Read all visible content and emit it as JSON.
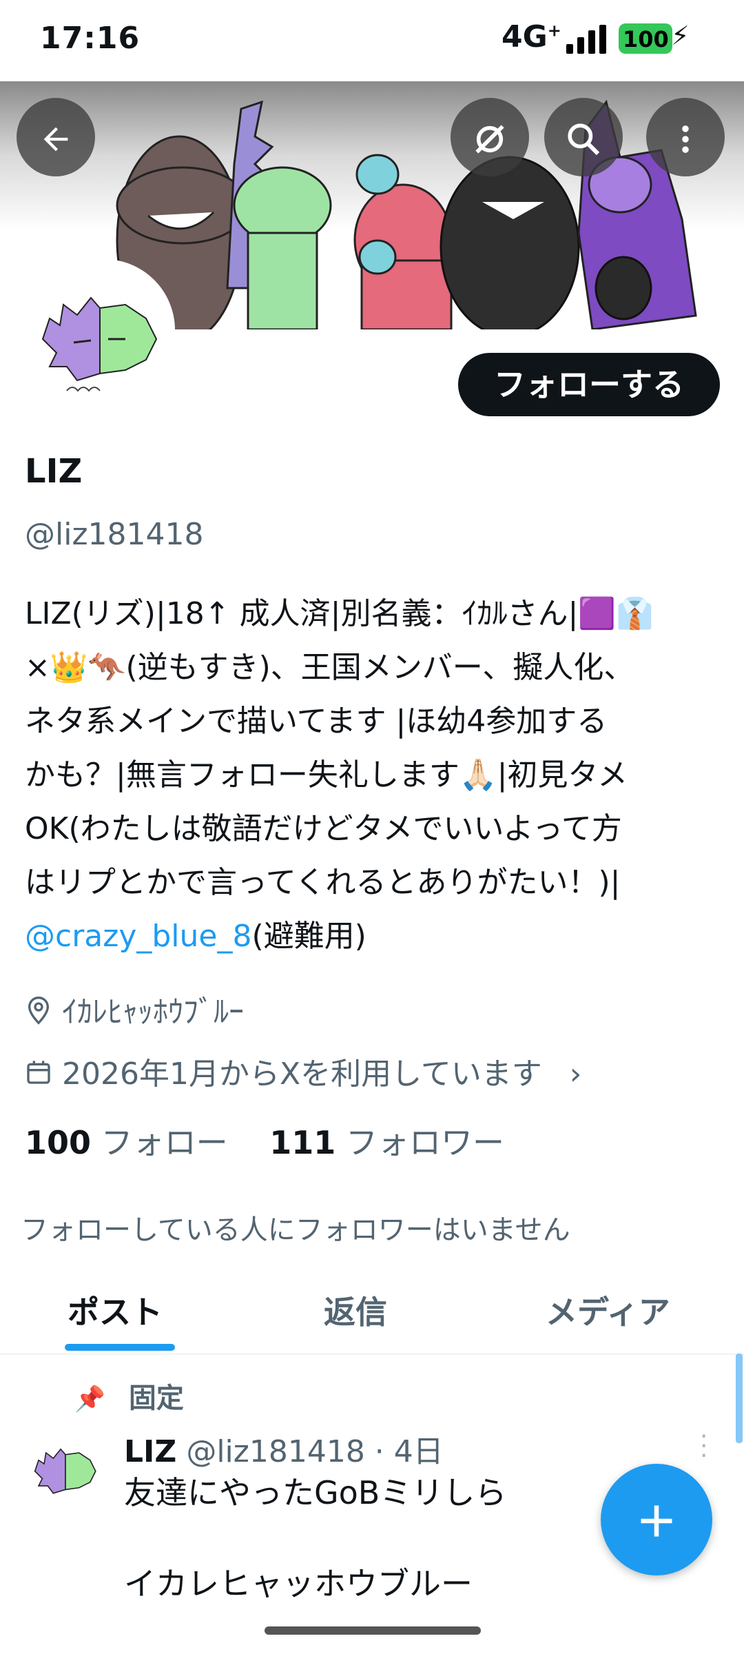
{
  "status_bar": {
    "time": "17:16",
    "network": "4G",
    "network_sup": "+",
    "battery": "100"
  },
  "header": {
    "back_icon": "arrow-left-icon",
    "grok_icon": "grok-icon",
    "search_icon": "search-icon",
    "more_icon": "more-vertical-icon"
  },
  "profile": {
    "follow_button": "フォローする",
    "name": "LIZ",
    "handle": "@liz181418",
    "bio_line1": "LIZ(リズ)|18↑ 成人済|別名義：ｲｶﾙさん|🟪👔",
    "bio_line2": "×👑🦘(逆もすき)、王国メンバー、擬人化、",
    "bio_line3": "ネタ系メインで描いてます |ほ幼4参加する",
    "bio_line4": "かも？|無言フォロー失礼します🙏🏻|初見タメ",
    "bio_line5": "OK(わたしは敬語だけどタメでいいよって方",
    "bio_line6": "はリプとかで言ってくれるとありがたい！)|",
    "bio_mention": "@crazy_blue_8",
    "bio_mention_suffix": "(避難用)",
    "location": "ｲｶﾚﾋｬｯﾎｳﾌﾞﾙｰ",
    "joined": "2026年1月からXを利用しています",
    "following_count": "100",
    "following_label": "フォロー",
    "followers_count": "111",
    "followers_label": "フォロワー",
    "followers_you_know": "フォローしている人にフォロワーはいません"
  },
  "tabs": [
    {
      "label": "ポスト",
      "active": true
    },
    {
      "label": "返信",
      "active": false
    },
    {
      "label": "メディア",
      "active": false
    }
  ],
  "post": {
    "pinned_label": "固定",
    "author": "LIZ",
    "handle_time": "@liz181418 · 4日",
    "text_line1": "友達にやったGoBミリしら",
    "text_line2": "イカレヒャッホウブルー"
  },
  "fab_icon": "plus-icon",
  "colors": {
    "accent": "#1d9bf0",
    "follow_button": "#0f1419",
    "secondary_text": "#536471"
  }
}
